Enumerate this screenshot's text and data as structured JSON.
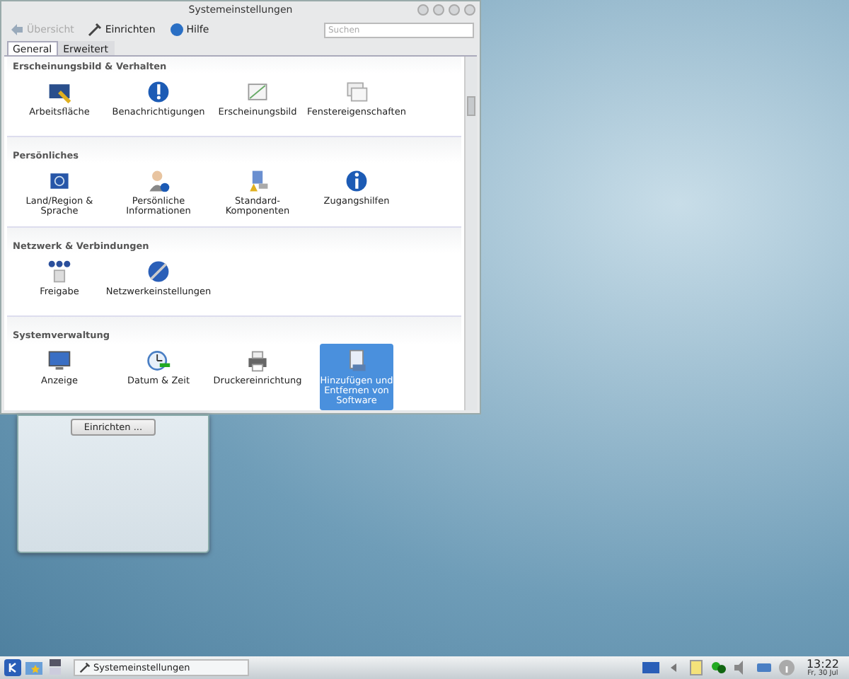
{
  "window": {
    "title": "Systemeinstellungen"
  },
  "toolbar": [
    {
      "label": "Übersicht",
      "disabled": true
    },
    {
      "label": "Einrichten",
      "disabled": false
    },
    {
      "label": "Hilfe",
      "disabled": false
    }
  ],
  "search": {
    "placeholder": "Suchen"
  },
  "tabs": [
    {
      "label": "General",
      "selected": true
    },
    {
      "label": "Erweitert",
      "selected": false
    }
  ],
  "sections": [
    {
      "title": "Erscheinungsbild & Verhalten",
      "items": [
        {
          "label": "Arbeitsfläche",
          "selected": false
        },
        {
          "label": "Benachrichtigungen",
          "selected": false
        },
        {
          "label": "Erscheinungsbild",
          "selected": false
        },
        {
          "label": "Fenstereigenschaften",
          "selected": false
        }
      ]
    },
    {
      "title": "Persönliches",
      "items": [
        {
          "label": "Land/Region & Sprache",
          "selected": false
        },
        {
          "label": "Persönliche Informationen",
          "selected": false
        },
        {
          "label": "Standard-Komponenten",
          "selected": false
        },
        {
          "label": "Zugangshilfen",
          "selected": false
        }
      ]
    },
    {
      "title": "Netzwerk & Verbindungen",
      "items": [
        {
          "label": "Freigabe",
          "selected": false
        },
        {
          "label": "Netzwerkeinstellungen",
          "selected": false
        }
      ]
    },
    {
      "title": "Systemverwaltung",
      "items": [
        {
          "label": "Anzeige",
          "selected": false
        },
        {
          "label": "Datum & Zeit",
          "selected": false
        },
        {
          "label": "Druckereinrichtung",
          "selected": false
        },
        {
          "label": "Hinzufügen und Entfernen von Software",
          "selected": true
        }
      ]
    }
  ],
  "widget": {
    "button": "Einrichten ..."
  },
  "taskbar": {
    "task": "Systemeinstellungen",
    "time": "13:22",
    "date": "Fr, 30 Jul"
  }
}
